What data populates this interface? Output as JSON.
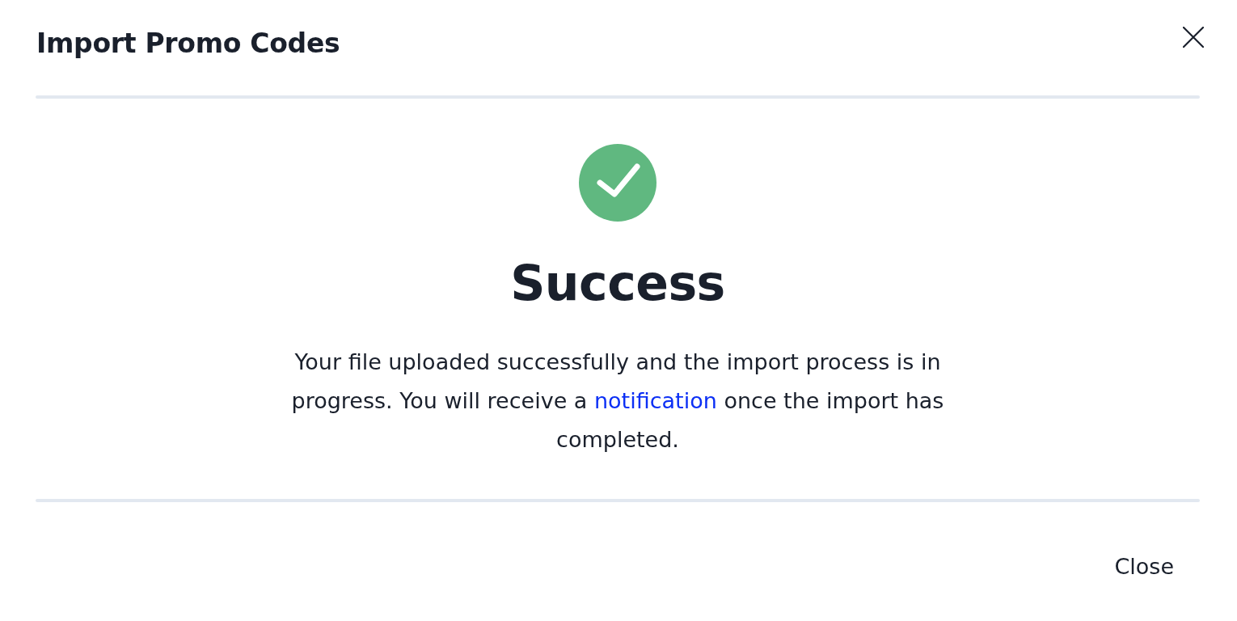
{
  "dialog": {
    "title": "Import Promo Codes"
  },
  "status": {
    "kind": "success",
    "heading": "Success"
  },
  "message": {
    "before": "Your file uploaded successfully and the import process is in progress. You will receive a",
    "link": "notification",
    "after": "once the import has completed."
  },
  "footer": {
    "buttons": [
      "Close"
    ]
  }
}
